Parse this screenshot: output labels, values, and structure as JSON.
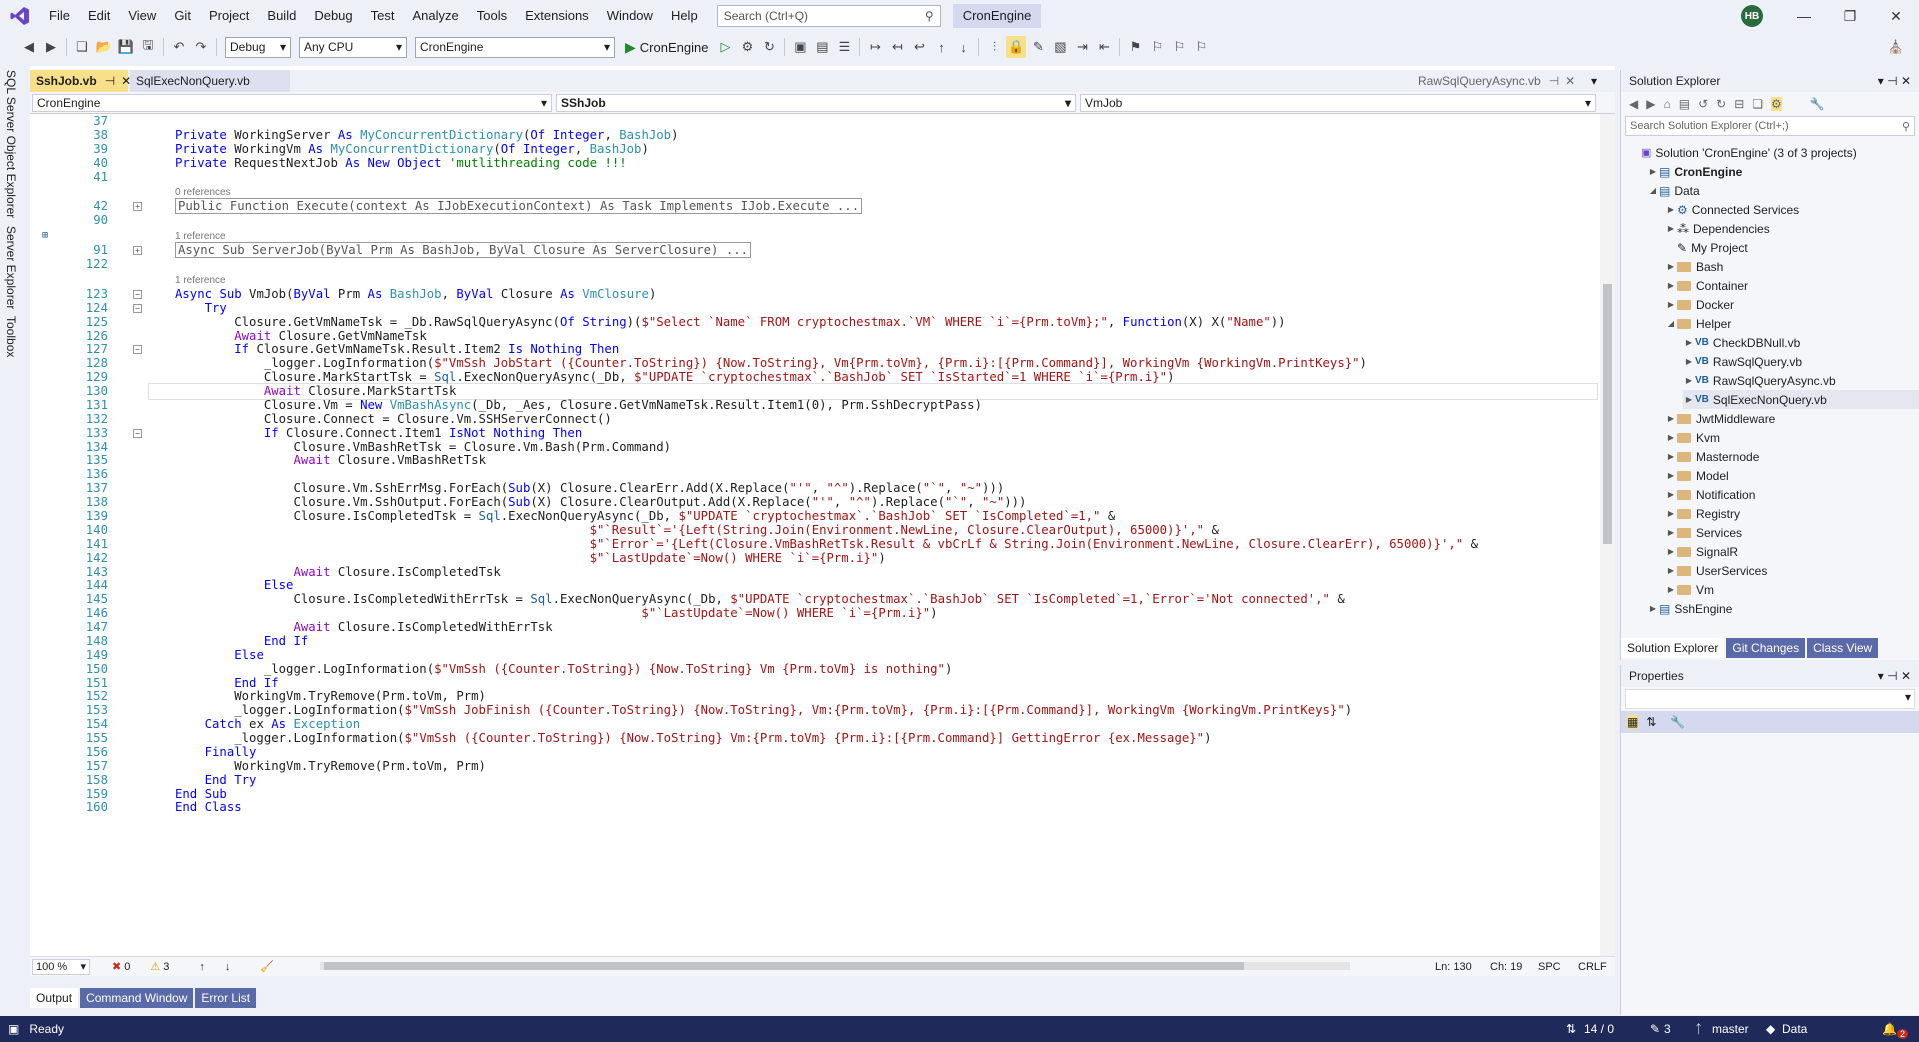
{
  "titlebar": {
    "menus": [
      "File",
      "Edit",
      "View",
      "Git",
      "Project",
      "Build",
      "Debug",
      "Test",
      "Analyze",
      "Tools",
      "Extensions",
      "Window",
      "Help"
    ],
    "search_placeholder": "Search (Ctrl+Q)",
    "solution_name": "CronEngine",
    "avatar_initials": "HB"
  },
  "toolbar": {
    "config": "Debug",
    "platform": "Any CPU",
    "startup_project": "CronEngine",
    "start_label": "CronEngine"
  },
  "left_tabs": [
    "SQL Server Object Explorer",
    "Server Explorer",
    "Toolbox"
  ],
  "editor": {
    "tabs": [
      {
        "label": "SshJob.vb",
        "active": true
      },
      {
        "label": "SqlExecNonQuery.vb",
        "active": false
      }
    ],
    "right_tab": "RawSqlQueryAsync.vb",
    "nav_project": "CronEngine",
    "nav_class": "SShJob",
    "nav_member": "VmJob",
    "zoom": "100 %",
    "errors": "0",
    "warnings": "3",
    "ln": "Ln: 130",
    "ch": "Ch: 19",
    "spc": "SPC",
    "crlf": "CRLF",
    "ref_0": "0 references",
    "ref_1a": "1 reference",
    "ref_1b": "1 reference"
  },
  "code_lines": [
    {
      "n": "37",
      "t": ""
    },
    {
      "n": "38",
      "t": "Private WorkingServer As MyConcurrentDictionary(Of Integer, BashJob)"
    },
    {
      "n": "39",
      "t": "Private WorkingVm As MyConcurrentDictionary(Of Integer, BashJob)"
    },
    {
      "n": "40",
      "t": "Private RequestNextJob As New Object 'mutlithreading code !!!"
    },
    {
      "n": "41",
      "t": ""
    },
    {
      "n": "42",
      "t": "Public Function Execute(context As IJobExecutionContext) As Task Implements IJob.Execute ..."
    },
    {
      "n": "90",
      "t": ""
    },
    {
      "n": "91",
      "t": "Async Sub ServerJob(ByVal Prm As BashJob, ByVal Closure As ServerClosure) ..."
    },
    {
      "n": "122",
      "t": ""
    },
    {
      "n": "123",
      "t": "Async Sub VmJob(ByVal Prm As BashJob, ByVal Closure As VmClosure)"
    },
    {
      "n": "124",
      "t": "    Try"
    },
    {
      "n": "125",
      "t": "        Closure.GetVmNameTsk = _Db.RawSqlQueryAsync(Of String)($\"Select `Name` FROM cryptochestmax.`VM` WHERE `i`={Prm.toVm};\", Function(X) X(\"Name\"))"
    },
    {
      "n": "126",
      "t": "        Await Closure.GetVmNameTsk"
    },
    {
      "n": "127",
      "t": "        If Closure.GetVmNameTsk.Result.Item2 Is Nothing Then"
    },
    {
      "n": "128",
      "t": "            _logger.LogInformation($\"VmSsh JobStart ({Counter.ToString}) {Now.ToString}, Vm{Prm.toVm}, {Prm.i}:[{Prm.Command}], WorkingVm {WorkingVm.PrintKeys}\")"
    },
    {
      "n": "129",
      "t": "            Closure.MarkStartTsk = Sql.ExecNonQueryAsync(_Db, $\"UPDATE `cryptochestmax`.`BashJob` SET `IsStarted`=1 WHERE `i`={Prm.i}\")"
    },
    {
      "n": "130",
      "t": "            Await Closure.MarkStartTsk"
    },
    {
      "n": "131",
      "t": "            Closure.Vm = New VmBashAsync(_Db, _Aes, Closure.GetVmNameTsk.Result.Item1(0), Prm.SshDecryptPass)"
    },
    {
      "n": "132",
      "t": "            Closure.Connect = Closure.Vm.SSHServerConnect()"
    },
    {
      "n": "133",
      "t": "            If Closure.Connect.Item1 IsNot Nothing Then"
    },
    {
      "n": "134",
      "t": "                Closure.VmBashRetTsk = Closure.Vm.Bash(Prm.Command)"
    },
    {
      "n": "135",
      "t": "                Await Closure.VmBashRetTsk"
    },
    {
      "n": "136",
      "t": ""
    },
    {
      "n": "137",
      "t": "                Closure.Vm.SshErrMsg.ForEach(Sub(X) Closure.ClearErr.Add(X.Replace(\"'\", \"^\").Replace(\"`\", \"~\")))"
    },
    {
      "n": "138",
      "t": "                Closure.Vm.SshOutput.ForEach(Sub(X) Closure.ClearOutput.Add(X.Replace(\"'\", \"^\").Replace(\"`\", \"~\")))"
    },
    {
      "n": "139",
      "t": "                Closure.IsCompletedTsk = Sql.ExecNonQueryAsync(_Db, $\"UPDATE `cryptochestmax`.`BashJob` SET `IsCompleted`=1,\" &"
    },
    {
      "n": "140",
      "t": "                                                        $\"`Result`='{Left(String.Join(Environment.NewLine, Closure.ClearOutput), 65000)}',\" &"
    },
    {
      "n": "141",
      "t": "                                                        $\"`Error`='{Left(Closure.VmBashRetTsk.Result & vbCrLf & String.Join(Environment.NewLine, Closure.ClearErr), 65000)}',\" &"
    },
    {
      "n": "142",
      "t": "                                                        $\"`LastUpdate`=Now() WHERE `i`={Prm.i}\")"
    },
    {
      "n": "143",
      "t": "                Await Closure.IsCompletedTsk"
    },
    {
      "n": "144",
      "t": "            Else"
    },
    {
      "n": "145",
      "t": "                Closure.IsCompletedWithErrTsk = Sql.ExecNonQueryAsync(_Db, $\"UPDATE `cryptochestmax`.`BashJob` SET `IsCompleted`=1,`Error`='Not connected',\" &"
    },
    {
      "n": "146",
      "t": "                                                               $\"`LastUpdate`=Now() WHERE `i`={Prm.i}\")"
    },
    {
      "n": "147",
      "t": "                Await Closure.IsCompletedWithErrTsk"
    },
    {
      "n": "148",
      "t": "            End If"
    },
    {
      "n": "149",
      "t": "        Else"
    },
    {
      "n": "150",
      "t": "            _logger.LogInformation($\"VmSsh ({Counter.ToString}) {Now.ToString} Vm {Prm.toVm} is nothing\")"
    },
    {
      "n": "151",
      "t": "        End If"
    },
    {
      "n": "152",
      "t": "        WorkingVm.TryRemove(Prm.toVm, Prm)"
    },
    {
      "n": "153",
      "t": "        _logger.LogInformation($\"VmSsh JobFinish ({Counter.ToString}) {Now.ToString}, Vm:{Prm.toVm}, {Prm.i}:[{Prm.Command}], WorkingVm {WorkingVm.PrintKeys}\")"
    },
    {
      "n": "154",
      "t": "    Catch ex As Exception"
    },
    {
      "n": "155",
      "t": "        _logger.LogInformation($\"VmSsh ({Counter.ToString}) {Now.ToString} Vm:{Prm.toVm} {Prm.i}:[{Prm.Command}] GettingError {ex.Message}\")"
    },
    {
      "n": "156",
      "t": "    Finally"
    },
    {
      "n": "157",
      "t": "        WorkingVm.TryRemove(Prm.toVm, Prm)"
    },
    {
      "n": "158",
      "t": "    End Try"
    },
    {
      "n": "159",
      "t": "End Sub"
    },
    {
      "n": "160",
      "t": "End Class"
    }
  ],
  "solution_explorer": {
    "title": "Solution Explorer",
    "search_placeholder": "Search Solution Explorer (Ctrl+;)",
    "items": [
      {
        "label": "Solution 'CronEngine' (3 of 3 projects)",
        "indent": 0,
        "kind": "solution",
        "arrow": ""
      },
      {
        "label": "CronEngine",
        "indent": 1,
        "kind": "project-bold",
        "arrow": "▶"
      },
      {
        "label": "Data",
        "indent": 1,
        "kind": "project",
        "arrow": "◢"
      },
      {
        "label": "Connected Services",
        "indent": 2,
        "kind": "service",
        "arrow": "▶"
      },
      {
        "label": "Dependencies",
        "indent": 2,
        "kind": "deps",
        "arrow": "▶"
      },
      {
        "label": "My Project",
        "indent": 2,
        "kind": "myproject",
        "arrow": ""
      },
      {
        "label": "Bash",
        "indent": 2,
        "kind": "folder",
        "arrow": "▶"
      },
      {
        "label": "Container",
        "indent": 2,
        "kind": "folder",
        "arrow": "▶"
      },
      {
        "label": "Docker",
        "indent": 2,
        "kind": "folder",
        "arrow": "▶"
      },
      {
        "label": "Helper",
        "indent": 2,
        "kind": "folder",
        "arrow": "◢"
      },
      {
        "label": "CheckDBNull.vb",
        "indent": 3,
        "kind": "vb",
        "arrow": "▶"
      },
      {
        "label": "RawSqlQuery.vb",
        "indent": 3,
        "kind": "vb",
        "arrow": "▶"
      },
      {
        "label": "RawSqlQueryAsync.vb",
        "indent": 3,
        "kind": "vb",
        "arrow": "▶"
      },
      {
        "label": "SqlExecNonQuery.vb",
        "indent": 3,
        "kind": "vb",
        "arrow": "▶"
      },
      {
        "label": "JwtMiddleware",
        "indent": 2,
        "kind": "folder",
        "arrow": "▶"
      },
      {
        "label": "Kvm",
        "indent": 2,
        "kind": "folder",
        "arrow": "▶"
      },
      {
        "label": "Masternode",
        "indent": 2,
        "kind": "folder",
        "arrow": "▶"
      },
      {
        "label": "Model",
        "indent": 2,
        "kind": "folder",
        "arrow": "▶"
      },
      {
        "label": "Notification",
        "indent": 2,
        "kind": "folder",
        "arrow": "▶"
      },
      {
        "label": "Registry",
        "indent": 2,
        "kind": "folder",
        "arrow": "▶"
      },
      {
        "label": "Services",
        "indent": 2,
        "kind": "folder",
        "arrow": "▶"
      },
      {
        "label": "SignalR",
        "indent": 2,
        "kind": "folder",
        "arrow": "▶"
      },
      {
        "label": "UserServices",
        "indent": 2,
        "kind": "folder",
        "arrow": "▶"
      },
      {
        "label": "Vm",
        "indent": 2,
        "kind": "folder",
        "arrow": "▶"
      },
      {
        "label": "SshEngine",
        "indent": 1,
        "kind": "project",
        "arrow": "▶"
      }
    ],
    "tabs": [
      "Solution Explorer",
      "Git Changes",
      "Class View"
    ]
  },
  "properties": {
    "title": "Properties"
  },
  "output_tabs": [
    "Output",
    "Command Window",
    "Error List"
  ],
  "statusbar": {
    "ready": "Ready",
    "lines": "14 / 0",
    "pencil": "3",
    "branch": "master",
    "repo": "Data",
    "bell": "2"
  }
}
